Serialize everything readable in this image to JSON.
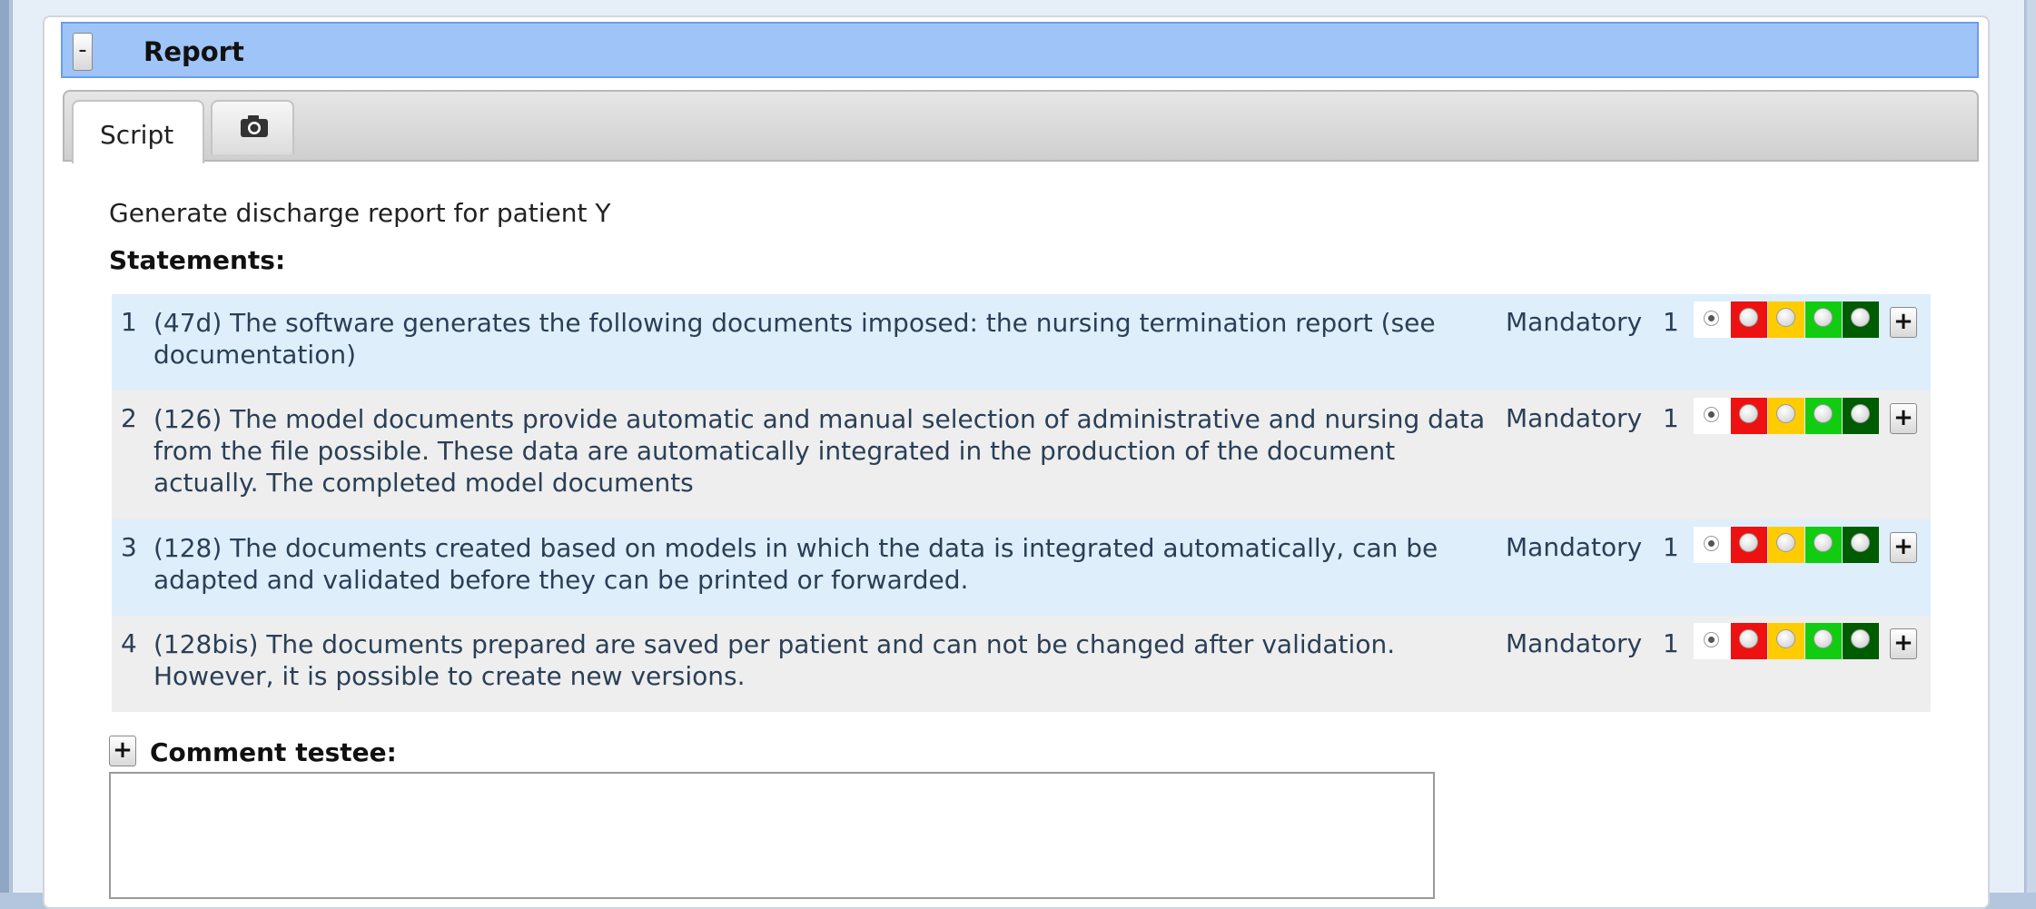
{
  "report": {
    "collapse_label": "-",
    "title": "Report"
  },
  "tabs": [
    {
      "label": "Script",
      "active": true
    },
    {
      "label": "",
      "icon": "camera-icon",
      "active": false
    }
  ],
  "description": "Generate discharge report for patient Y",
  "statements_label": "Statements:",
  "statements": [
    {
      "number": "1",
      "text": "(47d) The software generates the following documents imposed: the nursing termination report (see documentation)",
      "type": "Mandatory",
      "weight": "1",
      "rating": "none"
    },
    {
      "number": "2",
      "text": "(126) The model documents provide automatic and manual selection of administrative and nursing data from the file possible. These data are automatically integrated in the production of the document actually. The completed model documents",
      "type": "Mandatory",
      "weight": "1",
      "rating": "none"
    },
    {
      "number": "3",
      "text": "(128) The documents created based on models in which the data is integrated automatically, can be adapted and validated before they can be printed or forwarded.",
      "type": "Mandatory",
      "weight": "1",
      "rating": "none"
    },
    {
      "number": "4",
      "text": "(128bis) The documents prepared are saved per patient and can not be changed after validation. However, it is possible to create new versions.",
      "type": "Mandatory",
      "weight": "1",
      "rating": "none"
    }
  ],
  "rating_colors": {
    "none": "#ffffff",
    "red": "#ee1111",
    "yellow": "#ffcc00",
    "green": "#11cc11",
    "dark_green": "#005c00"
  },
  "expand_label": "+",
  "comment": {
    "expand_label": "+",
    "label": "Comment testee:",
    "value": ""
  }
}
